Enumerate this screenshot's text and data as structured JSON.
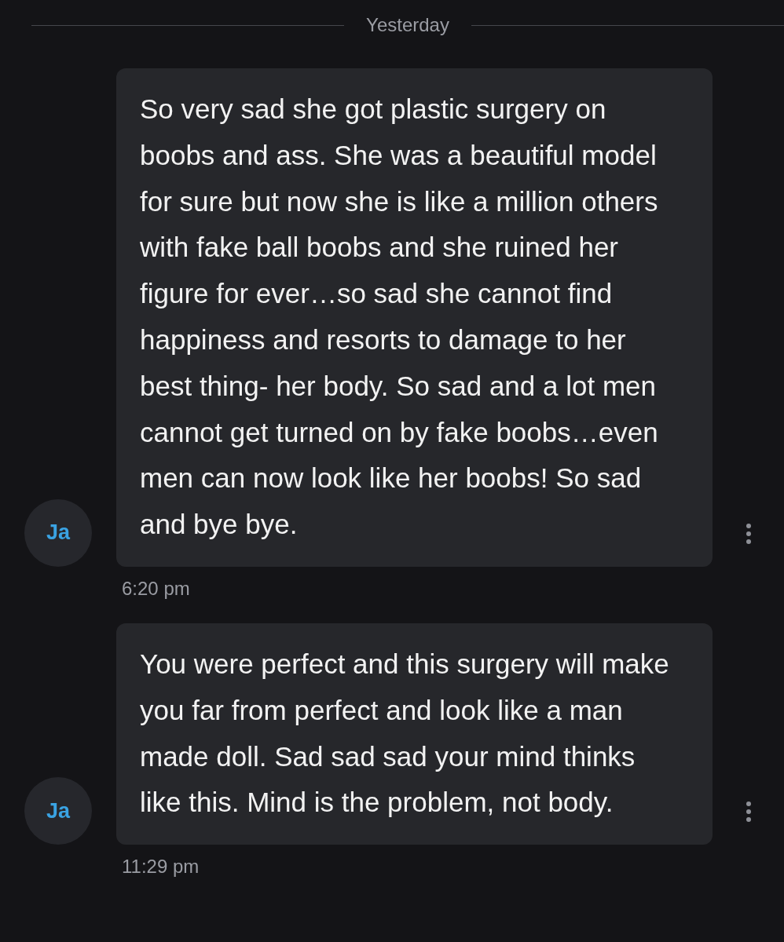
{
  "date_divider": "Yesterday",
  "messages": [
    {
      "avatar": "Ja",
      "text": "So very sad she got plastic surgery on boobs and ass. She was a beautiful model for sure but now she is like a million others with fake ball boobs and she ruined her figure for ever…so sad she cannot find happiness and resorts to damage to her best thing- her body. So sad and a lot men cannot get turned on by fake boobs…even men can now look like her boobs! So sad and bye bye.",
      "time": "6:20 pm"
    },
    {
      "avatar": "Ja",
      "text": "You were perfect and this surgery will make you far from perfect and look like a man made doll. Sad sad sad your mind thinks like this. Mind is the problem, not body.",
      "time": "11:29 pm"
    }
  ]
}
